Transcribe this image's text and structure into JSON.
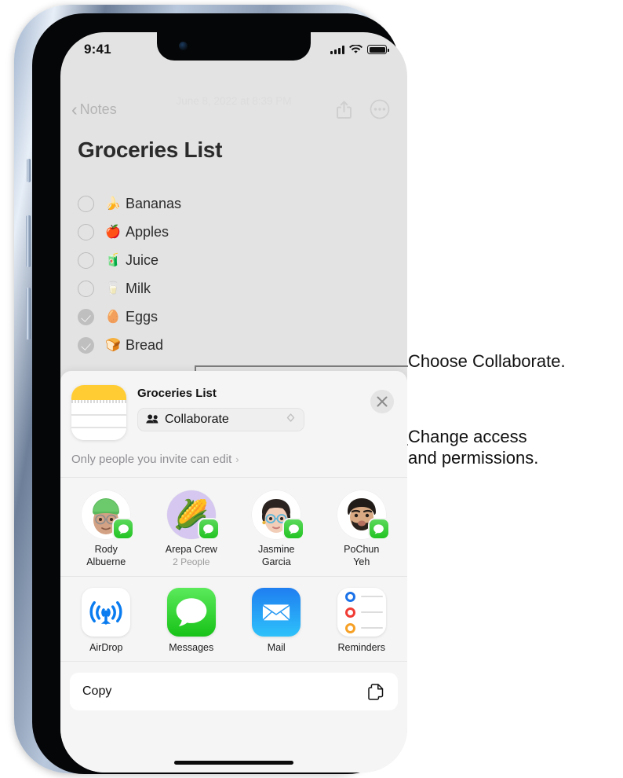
{
  "status_bar": {
    "time": "9:41",
    "signal_icon": "cellular-bars-icon",
    "wifi_icon": "wifi-icon",
    "battery_icon": "battery-full-icon"
  },
  "notes_app": {
    "back_label": "Notes",
    "back_icon": "chevron-left-icon",
    "share_icon": "share-icon",
    "more_icon": "more-circle-icon",
    "date": "June 8, 2022 at 8:39 PM",
    "title": "Groceries List",
    "checklist": [
      {
        "emoji": "🍌",
        "label": "Bananas",
        "checked": false
      },
      {
        "emoji": "🍎",
        "label": "Apples",
        "checked": false
      },
      {
        "emoji": "🧃",
        "label": "Juice",
        "checked": false
      },
      {
        "emoji": "🥛",
        "label": "Milk",
        "checked": false
      },
      {
        "emoji": "🥚",
        "label": "Eggs",
        "checked": true
      },
      {
        "emoji": "🍞",
        "label": "Bread",
        "checked": true
      }
    ]
  },
  "share_sheet": {
    "doc_icon": "notes-document-icon",
    "title": "Groceries List",
    "collaborate": {
      "icon": "people-icon",
      "label": "Collaborate",
      "chevron_icon": "chevron-up-down-icon"
    },
    "close_icon": "close-icon",
    "access": {
      "text": "Only people you invite can edit",
      "chevron_icon": "chevron-right-icon"
    },
    "people": [
      {
        "name_line1": "Rody",
        "name_line2": "Albuerne",
        "sub": "",
        "avatar": "memoji-green-beanie",
        "emoji": "🧑🏽‍🦱",
        "badge": "messages-badge-icon",
        "style": "white"
      },
      {
        "name_line1": "Arepa Crew",
        "name_line2": "",
        "sub": "2 People",
        "avatar": "corn-group-avatar",
        "emoji": "🌽",
        "badge": "messages-badge-icon",
        "style": "purple"
      },
      {
        "name_line1": "Jasmine",
        "name_line2": "Garcia",
        "sub": "",
        "avatar": "memoji-glasses",
        "emoji": "👩🏻",
        "badge": "messages-badge-icon",
        "style": "white"
      },
      {
        "name_line1": "PoChun",
        "name_line2": "Yeh",
        "sub": "",
        "avatar": "memoji-beard",
        "emoji": "🧔🏻",
        "badge": "messages-badge-icon",
        "style": "white"
      }
    ],
    "apps": [
      {
        "name": "AirDrop",
        "icon": "airdrop-icon"
      },
      {
        "name": "Messages",
        "icon": "messages-icon"
      },
      {
        "name": "Mail",
        "icon": "mail-icon"
      },
      {
        "name": "Reminders",
        "icon": "reminders-icon"
      }
    ],
    "actions": [
      {
        "label": "Copy",
        "icon": "copy-documents-icon"
      }
    ]
  },
  "callouts": [
    {
      "text": "Choose Collaborate."
    },
    {
      "line1": "Change access",
      "line2": "and permissions."
    }
  ],
  "colors": {
    "notes_yellow": "#ffcc33",
    "messages_green": "#22c322",
    "mail_blue": "#1f7ef0",
    "sheet_bg": "#f5f5f5",
    "screen_bg": "#e3e3e3"
  }
}
